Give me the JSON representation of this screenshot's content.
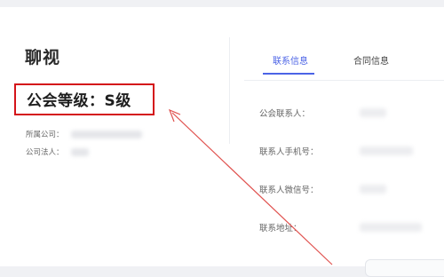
{
  "guild": {
    "name": "聊视",
    "level_text": "公会等级：S级"
  },
  "left_fields": [
    {
      "label": "所属公司："
    },
    {
      "label": "公司法人："
    }
  ],
  "tabs": [
    {
      "label": "联系信息",
      "active": true
    },
    {
      "label": "合同信息",
      "active": false
    }
  ],
  "contact_fields": [
    {
      "label": "公会联系人："
    },
    {
      "label": "联系人手机号："
    },
    {
      "label": "联系人微信号："
    },
    {
      "label": "联系地址："
    }
  ],
  "colors": {
    "highlight_box": "#d4141a",
    "arrow": "#e0524f",
    "tab_active": "#4b63e6"
  }
}
